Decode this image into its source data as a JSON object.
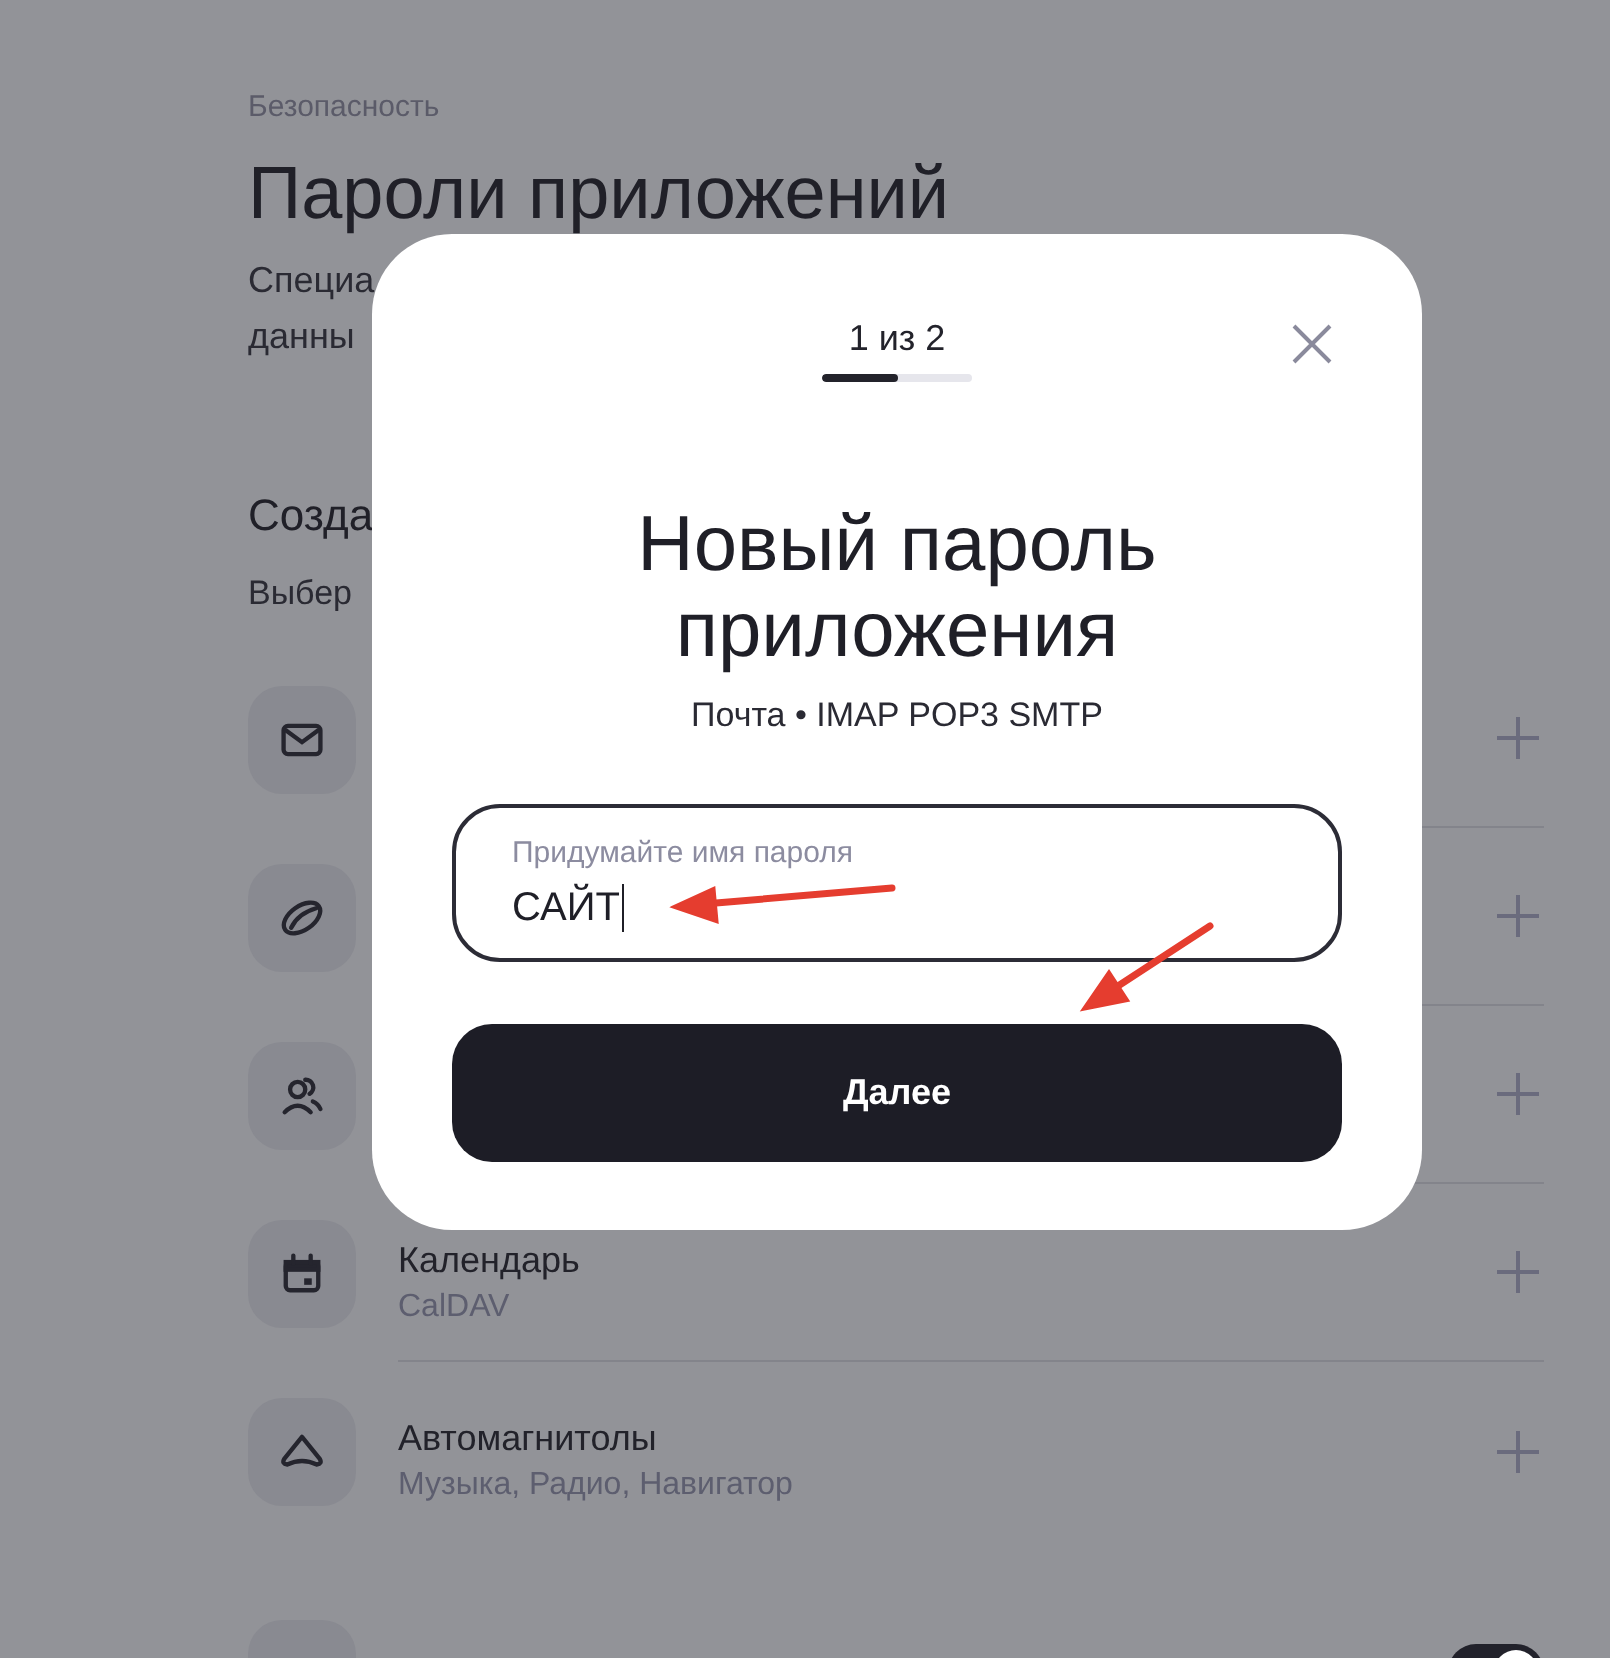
{
  "page": {
    "breadcrumb": "Безопасность",
    "title": "Пароли приложений",
    "description": [
      "Специа",
      "данны"
    ],
    "section_title": "Созда",
    "section_hint": "Выбер"
  },
  "app_types": [
    {
      "kind": "mail"
    },
    {
      "kind": "disk"
    },
    {
      "kind": "contacts"
    },
    {
      "kind": "calendar",
      "name": "Календарь",
      "detail": "CalDAV"
    },
    {
      "kind": "car",
      "name": "Автомагнитолы",
      "detail": "Музыка, Радио, Навигатор"
    }
  ],
  "settings_row": {
    "on": true
  },
  "modal": {
    "step": "1 из 2",
    "progress": {
      "level": 0.5
    },
    "title": "Новый пароль приложения",
    "subtitle": "Почта • IMAP POP3 SMTP",
    "field": {
      "label": "Придумайте имя пароля",
      "value": "САЙТ"
    },
    "button": "Далее"
  }
}
